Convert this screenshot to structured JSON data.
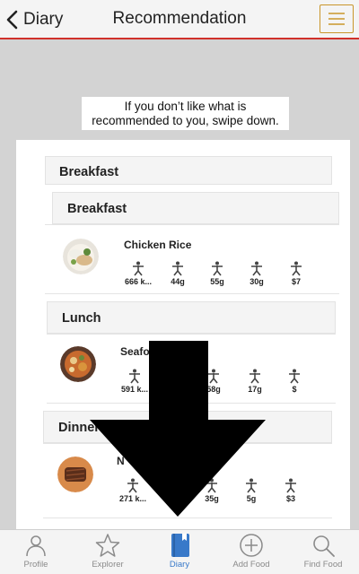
{
  "nav": {
    "back_label": "Diary",
    "title": "Recommendation"
  },
  "tip": {
    "line1": "If you don’t like what is",
    "line2": "recommended to you, swipe down."
  },
  "sections": {
    "header_top": "Breakfast",
    "breakfast_title": "Breakfast",
    "lunch_title": "Lunch",
    "dinner_title": "Dinner"
  },
  "meals": {
    "breakfast": {
      "name": "Chicken Rice",
      "nutrients": [
        "666 k...",
        "44g",
        "55g",
        "30g",
        "$7"
      ]
    },
    "lunch": {
      "name": "Seafo",
      "nutrients": [
        "591 k...",
        "",
        "58g",
        "17g",
        "$"
      ]
    },
    "dinner": {
      "name": "N",
      "nutrients": [
        "271 k...",
        "",
        "35g",
        "5g",
        "$3"
      ]
    }
  },
  "tabs": [
    {
      "label": "Profile",
      "icon": "person-icon"
    },
    {
      "label": "Explorer",
      "icon": "star-icon"
    },
    {
      "label": "Diary",
      "icon": "book-icon"
    },
    {
      "label": "Add Food",
      "icon": "plus-circle-icon"
    },
    {
      "label": "Find Food",
      "icon": "search-icon"
    }
  ],
  "colors": {
    "accent_red": "#d0302a",
    "menu_gold": "#c9962b",
    "tab_active": "#3879c9",
    "tab_inactive": "#8a8a8a"
  },
  "active_tab": "Diary"
}
